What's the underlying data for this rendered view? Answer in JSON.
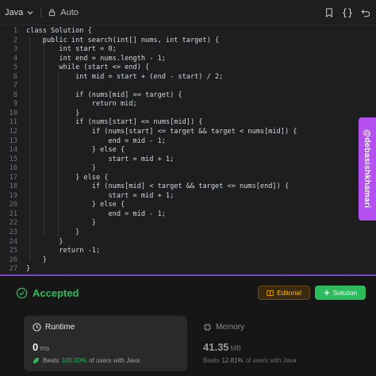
{
  "toolbar": {
    "language": "Java",
    "autocomplete": "Auto"
  },
  "code_lines": [
    "class Solution {",
    "    public int search(int[] nums, int target) {",
    "        int start = 0;",
    "        int end = nums.length - 1;",
    "        while (start <= end) {",
    "            int mid = start + (end - start) / 2;",
    "",
    "            if (nums[mid] == target) {",
    "                return mid;",
    "            }",
    "            if (nums[start] <= nums[mid]) {",
    "                if (nums[start] <= target && target < nums[mid]) {",
    "                    end = mid - 1;",
    "                } else {",
    "                    start = mid + 1;",
    "                }",
    "            } else {",
    "                if (nums[mid] < target && target <= nums[end]) {",
    "                    start = mid + 1;",
    "                } else {",
    "                    end = mid - 1;",
    "                }",
    "            }",
    "        }",
    "        return -1;",
    "    }",
    "}"
  ],
  "watermark": "@debasishkhamari",
  "result": {
    "status": "Accepted",
    "editorial_label": "Editorial",
    "solution_label": "Solution",
    "runtime": {
      "title": "Runtime",
      "value": "0",
      "unit": "ms",
      "beats_prefix": "Beats",
      "beats_pct": "100.00%",
      "beats_suffix": "of users with Java"
    },
    "memory": {
      "title": "Memory",
      "value": "41.35",
      "unit": "MB",
      "beats_prefix": "Beats",
      "beats_pct": "12.81%",
      "beats_suffix": "of users with Java"
    }
  },
  "colors": {
    "accepted": "#2cbb5d",
    "editorial": "#ffb800",
    "watermark_bg": "#b44ff0"
  }
}
